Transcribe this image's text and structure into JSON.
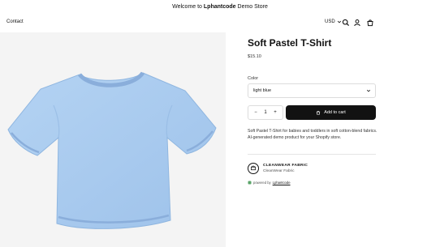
{
  "announcement": {
    "prefix": "Welcome to ",
    "brand": "Lphantcode",
    "suffix": " Demo Store"
  },
  "header": {
    "nav": [
      {
        "label": "Contact"
      }
    ],
    "currency": "USD",
    "icons": [
      "search-icon",
      "account-icon",
      "cart-icon"
    ]
  },
  "product": {
    "title": "Soft Pastel T-Shirt",
    "price": "$15.10",
    "color_label": "Color",
    "color_value": "light blue",
    "quantity": "1",
    "qty_minus": "−",
    "qty_plus": "+",
    "add_to_cart": "Add to cart",
    "description": "Soft Pastel T-Shirt for babies and toddlers in soft cotton-blend fabrics. AI-generated demo product for your Shopify store."
  },
  "fabric": {
    "title": "CLEANWEAR FABRIC",
    "subtitle": "CleanWear Fabric"
  },
  "powered": {
    "prefix": "powered by",
    "brand": "Lphantcode"
  },
  "colors": {
    "tshirt": "#a9ccf0",
    "tshirt_shadow": "#8fb6e0",
    "button": "#121212",
    "background": "#ffffff",
    "media_bg": "#f4f4f4"
  }
}
